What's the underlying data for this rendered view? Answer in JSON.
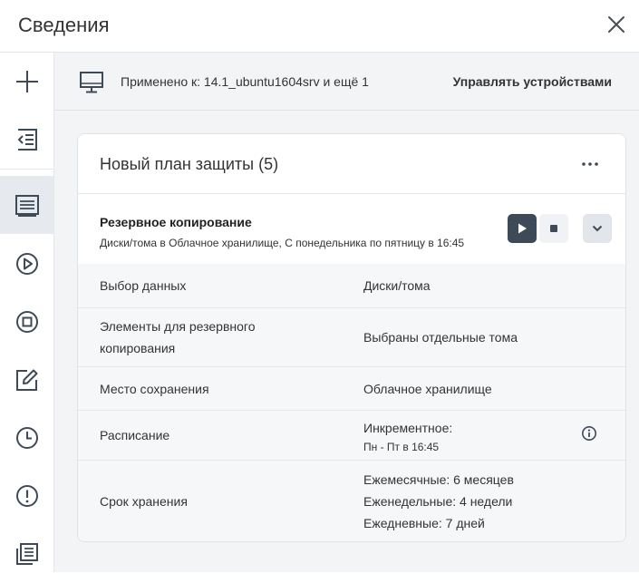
{
  "header": {
    "title": "Сведения"
  },
  "sidebar": {
    "items": [
      {
        "icon": "plus-icon"
      },
      {
        "icon": "collapse-list-icon"
      },
      {
        "icon": "plan-list-icon",
        "active": true
      },
      {
        "icon": "play-circle-icon"
      },
      {
        "icon": "stop-circle-icon"
      },
      {
        "icon": "edit-icon"
      },
      {
        "icon": "clock-icon"
      },
      {
        "icon": "alert-icon"
      },
      {
        "icon": "documents-icon"
      }
    ]
  },
  "topbar": {
    "applied_text": "Применено к: 14.1_ubuntu1604srv и ещё 1",
    "manage_label": "Управлять устройствами"
  },
  "plan": {
    "title": "Новый план защиты (5)",
    "backup": {
      "title": "Резервное копирование",
      "description": "Диски/тома в Облачное хранилище, С понедельника по пятницу в 16:45"
    },
    "rows": [
      {
        "label": "Выбор данных",
        "value": "Диски/тома"
      },
      {
        "label_line1": "Элементы для резервного",
        "label_line2": "копирования",
        "value": "Выбраны отдельные тома"
      },
      {
        "label": "Место сохранения",
        "value": "Облачное хранилище"
      },
      {
        "label": "Расписание",
        "value": "Инкрементное:",
        "sub": "Пн - Пт в 16:45"
      },
      {
        "label": "Срок хранения",
        "value_line1": "Ежемесячные: 6 месяцев",
        "value_line2": "Еженедельные: 4 недели",
        "value_line3": "Ежедневные: 7 дней"
      }
    ]
  },
  "colors": {
    "accent_dark": "#3e4a57",
    "sidebar_active": "#e6e9ed",
    "panel_bg": "#f3f4f6"
  }
}
